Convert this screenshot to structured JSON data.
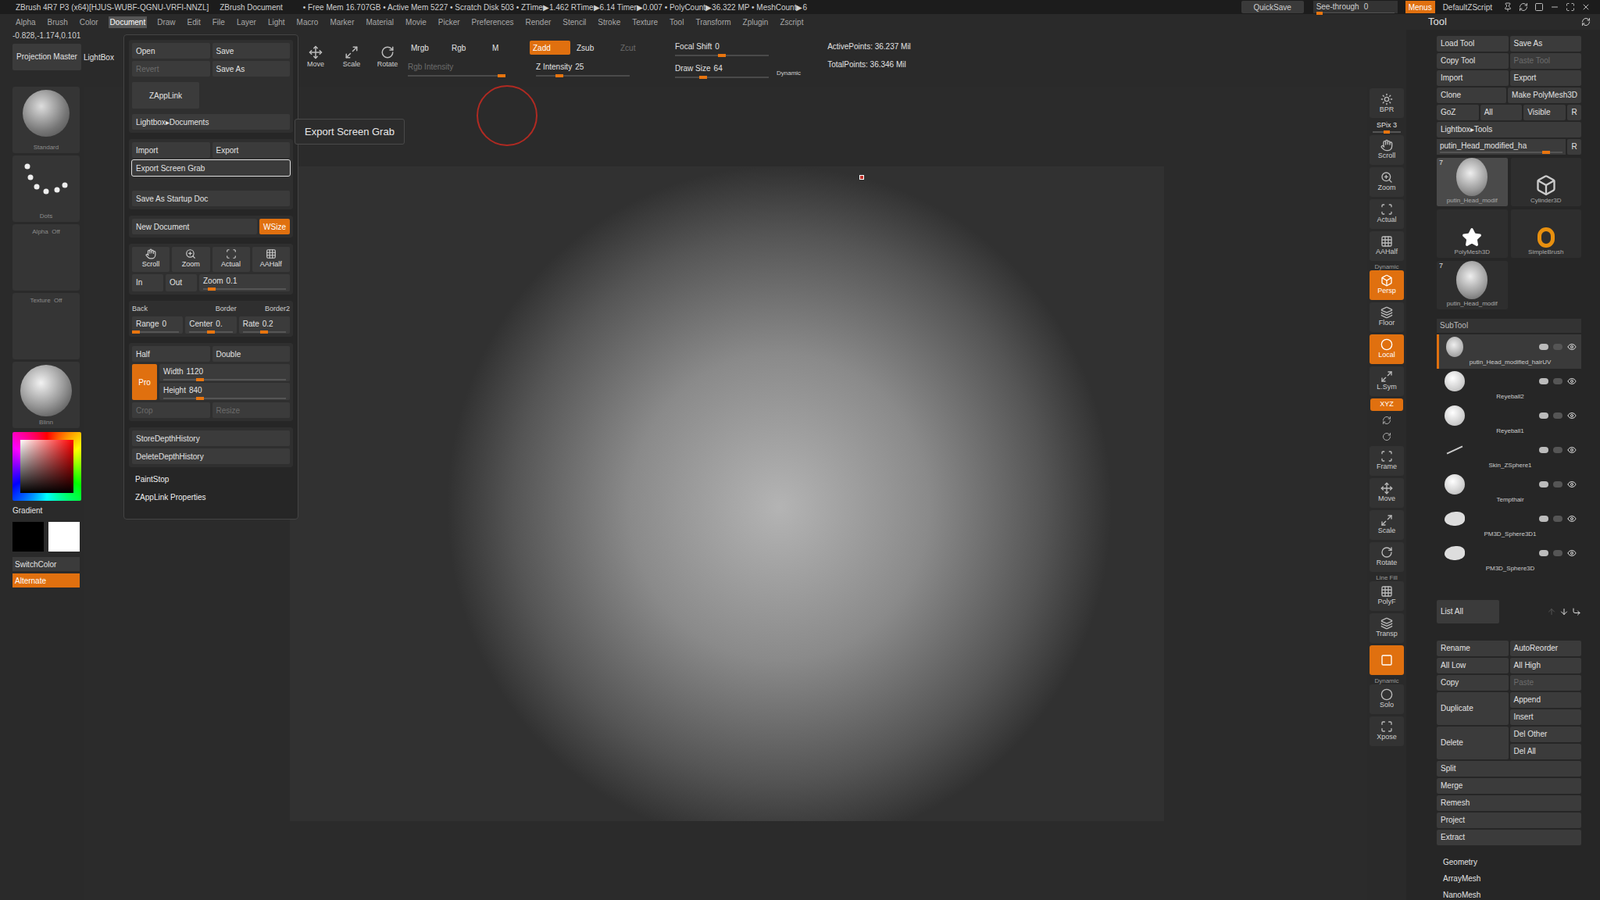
{
  "title_bar": {
    "app": "ZBrush 4R7 P3 (x64)[HJUS-WUBF-QGNU-VRFI-NNZL]",
    "document": "ZBrush Document",
    "stats": "• Free Mem 16.707GB • Active Mem 5227 • Scratch Disk 503 • ZTime▶1.462 RTime▶6.14 Timer▶0.007 • PolyCount▶36.322 MP • MeshCount▶6",
    "quicksave": "QuickSave",
    "see_through": {
      "label": "See-through",
      "value": "0",
      "level": 0
    },
    "menus": {
      "label": "Menus",
      "on": true
    },
    "script": "DefaultZScript"
  },
  "menu_bar": [
    {
      "label": "Alpha",
      "selected": false
    },
    {
      "label": "Brush",
      "selected": false
    },
    {
      "label": "Color",
      "selected": false
    },
    {
      "label": "Document",
      "selected": true
    },
    {
      "label": "Draw",
      "selected": false
    },
    {
      "label": "Edit",
      "selected": false
    },
    {
      "label": "File",
      "selected": false
    },
    {
      "label": "Layer",
      "selected": false
    },
    {
      "label": "Light",
      "selected": false
    },
    {
      "label": "Macro",
      "selected": false
    },
    {
      "label": "Marker",
      "selected": false
    },
    {
      "label": "Material",
      "selected": false
    },
    {
      "label": "Movie",
      "selected": false
    },
    {
      "label": "Picker",
      "selected": false
    },
    {
      "label": "Preferences",
      "selected": false
    },
    {
      "label": "Render",
      "selected": false
    },
    {
      "label": "Stencil",
      "selected": false
    },
    {
      "label": "Stroke",
      "selected": false
    },
    {
      "label": "Texture",
      "selected": false
    },
    {
      "label": "Tool",
      "selected": false
    },
    {
      "label": "Transform",
      "selected": false
    },
    {
      "label": "Zplugin",
      "selected": false
    },
    {
      "label": "Zscript",
      "selected": false
    }
  ],
  "top_shelf": {
    "coords": "-0.828,-1.174,0.101",
    "projection_master": "Projection Master",
    "lightbox": "LightBox",
    "transform": [
      {
        "label": "Move"
      },
      {
        "label": "Scale"
      },
      {
        "label": "Rotate"
      }
    ],
    "channels": [
      {
        "label": "Mrgb",
        "selected": false
      },
      {
        "label": "Rgb",
        "selected": false
      },
      {
        "label": "M",
        "selected": false
      }
    ],
    "z_modes": [
      {
        "label": "Zadd",
        "selected": true,
        "disabled": false
      },
      {
        "label": "Zsub",
        "selected": false,
        "disabled": false
      },
      {
        "label": "Zcut",
        "selected": false,
        "disabled": true
      }
    ],
    "rgb_intensity": {
      "label": "Rgb Intensity",
      "level": 1,
      "disabled": true
    },
    "z_intensity": {
      "label": "Z Intensity",
      "value": "25",
      "level": 0.25,
      "disabled": false
    },
    "focal_shift": {
      "label": "Focal Shift",
      "value": "0",
      "level": 0.5,
      "disabled": false
    },
    "draw_size": {
      "label": "Draw Size",
      "value": "64",
      "level": 0.3,
      "disabled": false
    },
    "dynamic": {
      "label": "Dynamic",
      "on": false
    },
    "active_points": "ActivePoints: 36.237 Mil",
    "total_points": "TotalPoints: 36.346 Mil"
  },
  "left_tray": {
    "tiles": [
      {
        "label": "Standard",
        "kind": "brush"
      },
      {
        "label": "Dots",
        "kind": "stroke"
      },
      {
        "label": "Alpha  Off",
        "kind": "alpha"
      },
      {
        "label": "Texture  Off",
        "kind": "texture"
      },
      {
        "label": "Blinn",
        "kind": "material"
      }
    ],
    "gradient": "Gradient",
    "main_color": "#000000",
    "secondary_color": "#ffffff",
    "switch_color": "SwitchColor",
    "alternate": {
      "label": "Alternate",
      "on": true
    }
  },
  "document_menu": {
    "open": "Open",
    "save": "Save",
    "revert": {
      "label": "Revert",
      "disabled": true
    },
    "save_as": "Save As",
    "zapplink": "ZAppLink",
    "lightbox": "Lightbox▸Documents",
    "import": "Import",
    "export": "Export",
    "export_screen_grab": {
      "label": "Export Screen Grab",
      "highlighted": true
    },
    "save_startup": "Save As Startup Doc",
    "new_document": "New Document",
    "wsize": {
      "label": "WSize",
      "on": true
    },
    "nav": [
      {
        "label": "Scroll"
      },
      {
        "label": "Zoom"
      },
      {
        "label": "Actual"
      },
      {
        "label": "AAHalf"
      }
    ],
    "zoom_in": "In",
    "zoom_out": "Out",
    "zoom": {
      "label": "Zoom",
      "value": "0.1",
      "level": 0.1
    },
    "back": "Back",
    "border": "Border",
    "border2": "Border2",
    "range": {
      "label": "Range",
      "value": "0",
      "level": 0
    },
    "center": {
      "label": "Center",
      "value": "0.",
      "level": 0.5
    },
    "rate": {
      "label": "Rate",
      "value": "0.2",
      "level": 0.5
    },
    "half": "Half",
    "double": "Double",
    "pro": {
      "label": "Pro",
      "on": true
    },
    "width": {
      "label": "Width",
      "value": "1120",
      "level": 0.3
    },
    "height": {
      "label": "Height",
      "value": "840",
      "level": 0.3
    },
    "crop": {
      "label": "Crop",
      "disabled": true
    },
    "resize": {
      "label": "Resize",
      "disabled": true
    },
    "store_depth": "StoreDepthHistory",
    "delete_depth": "DeleteDepthHistory",
    "paint_stop": "PaintStop",
    "zapplink_props": "ZAppLink Properties"
  },
  "tooltip": "Export Screen Grab",
  "right_shelf": [
    {
      "label": "BPR",
      "kind": "button",
      "on": false
    },
    {
      "label": "SPix 3",
      "kind": "slider",
      "level": 0.4
    },
    {
      "label": "Scroll",
      "kind": "button",
      "on": false
    },
    {
      "label": "Zoom",
      "kind": "button",
      "on": false
    },
    {
      "label": "Actual",
      "kind": "button",
      "on": false
    },
    {
      "label": "AAHalf",
      "kind": "button",
      "on": false
    },
    {
      "label": "Persp",
      "kind": "button",
      "on": true,
      "tag": "Dynamic"
    },
    {
      "label": "Floor",
      "kind": "button",
      "on": false
    },
    {
      "label": "Local",
      "kind": "button",
      "on": true
    },
    {
      "label": "L.Sym",
      "kind": "button",
      "on": false
    },
    {
      "label": "XYZ",
      "kind": "pill",
      "on": true
    },
    {
      "label": "",
      "kind": "mini",
      "on": false
    },
    {
      "label": "",
      "kind": "mini",
      "on": false
    },
    {
      "label": "Frame",
      "kind": "button",
      "on": false
    },
    {
      "label": "Move",
      "kind": "button",
      "on": false
    },
    {
      "label": "Scale",
      "kind": "button",
      "on": false
    },
    {
      "label": "Rotate",
      "kind": "button",
      "on": false
    },
    {
      "label": "PolyF",
      "kind": "button",
      "on": false,
      "tag": "Line Fill"
    },
    {
      "label": "Transp",
      "kind": "button",
      "on": false
    },
    {
      "label": "",
      "kind": "button",
      "on": true
    },
    {
      "label": "Solo",
      "kind": "button",
      "on": false,
      "tag": "Dynamic"
    },
    {
      "label": "Xpose",
      "kind": "button",
      "on": false
    }
  ],
  "tool_panel": {
    "title": "Tool",
    "rows": [
      [
        {
          "label": "Load Tool",
          "disabled": false
        },
        {
          "label": "Save As",
          "disabled": false
        }
      ],
      [
        {
          "label": "Copy Tool",
          "disabled": false
        },
        {
          "label": "Paste Tool",
          "disabled": true
        }
      ],
      [
        {
          "label": "Import",
          "disabled": false
        },
        {
          "label": "Export",
          "disabled": false
        }
      ],
      [
        {
          "label": "Clone",
          "disabled": false
        },
        {
          "label": "Make PolyMesh3D",
          "disabled": false
        }
      ],
      [
        {
          "label": "GoZ",
          "disabled": false
        },
        {
          "label": "All",
          "disabled": false
        },
        {
          "label": "Visible",
          "disabled": false
        },
        {
          "label": "R",
          "disabled": false
        }
      ],
      [
        {
          "label": "Lightbox▸Tools",
          "disabled": false
        }
      ]
    ],
    "current_tool": {
      "label": "putin_Head_modified_ha",
      "level": 0.9,
      "r": "R"
    },
    "tools": [
      {
        "label": "putin_Head_modif",
        "count": "7",
        "kind": "head",
        "selected": true
      },
      {
        "label": "Cylinder3D",
        "count": "",
        "kind": "cylinder",
        "selected": false
      },
      {
        "label": "PolyMesh3D",
        "count": "",
        "kind": "star",
        "selected": false
      },
      {
        "label": "SimpleBrush",
        "count": "",
        "kind": "brush",
        "selected": false
      },
      {
        "label": "putin_Head_modif",
        "count": "7",
        "kind": "head",
        "selected": false
      }
    ],
    "subtool": {
      "title": "SubTool",
      "items": [
        {
          "name": "putin_Head_modified_hairUV",
          "visible": true,
          "selected": true,
          "kind": "head"
        },
        {
          "name": "Reyeball2",
          "visible": true,
          "selected": false,
          "kind": "sphere"
        },
        {
          "name": "Reyeball1",
          "visible": true,
          "selected": false,
          "kind": "sphere"
        },
        {
          "name": "Skin_ZSphere1",
          "visible": true,
          "selected": false,
          "kind": "line"
        },
        {
          "name": "Tempthair",
          "visible": true,
          "selected": false,
          "kind": "sphere"
        },
        {
          "name": "PM3D_Sphere3D1",
          "visible": true,
          "selected": false,
          "kind": "blob"
        },
        {
          "name": "PM3D_Sphere3D",
          "visible": true,
          "selected": false,
          "kind": "blob"
        }
      ],
      "list_all": "List All"
    },
    "actions": [
      [
        {
          "label": "Rename",
          "disabled": false
        },
        {
          "label": "AutoReorder",
          "disabled": false
        }
      ],
      [
        {
          "label": "All Low",
          "disabled": false
        },
        {
          "label": "All High",
          "disabled": false
        }
      ],
      [
        {
          "label": "Copy",
          "disabled": false
        },
        {
          "label": "Paste",
          "disabled": true
        }
      ]
    ],
    "paired": [
      {
        "main": "Duplicate",
        "side": [
          "Append",
          "Insert"
        ]
      },
      {
        "main": "Delete",
        "side": [
          "Del Other",
          "Del All"
        ]
      }
    ],
    "singles": [
      "Split",
      "Merge",
      "Remesh",
      "Project",
      "Extract"
    ],
    "sections": [
      "Geometry",
      "ArrayMesh",
      "NanoMesh"
    ]
  }
}
